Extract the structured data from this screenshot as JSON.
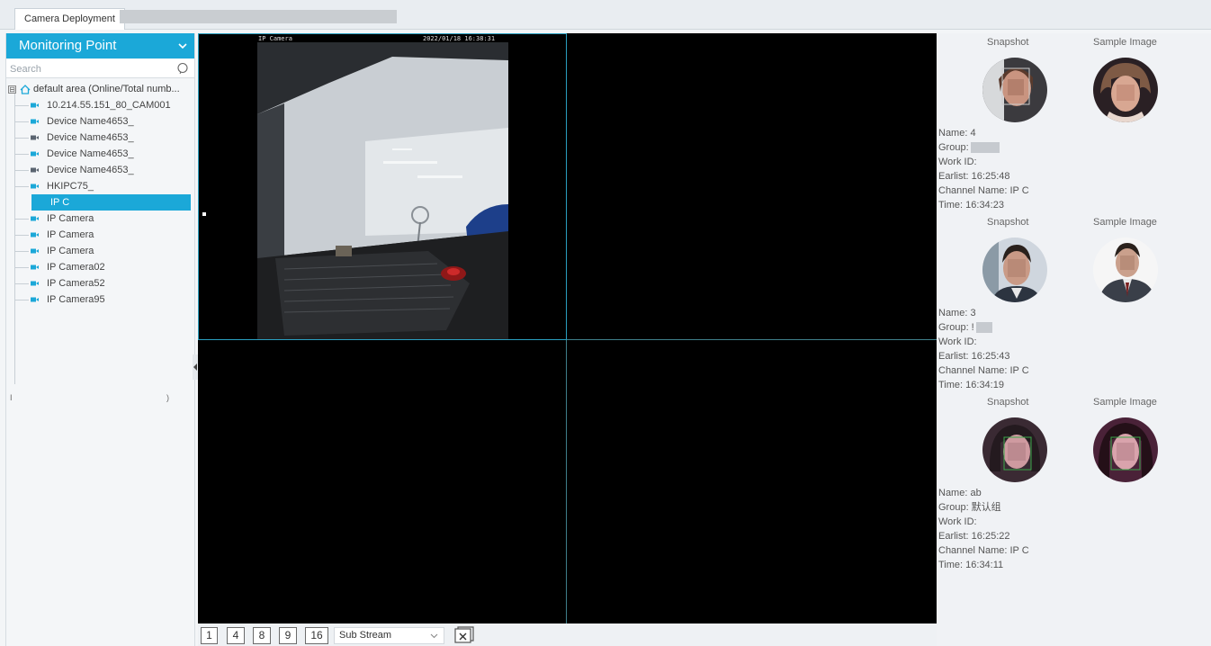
{
  "tabs": {
    "active_label": "Camera Deployment"
  },
  "sidebar": {
    "title": "Monitoring Point",
    "search_placeholder": "Search",
    "root_label": "default area (Online/Total numb...",
    "root_toggle": "⊟",
    "items": [
      {
        "label": "10.214.55.151_80_CAM001",
        "online": true
      },
      {
        "label": "Device Name4653_",
        "online": true
      },
      {
        "label": "Device Name4653_",
        "online": false
      },
      {
        "label": "Device Name4653_",
        "online": true
      },
      {
        "label": "Device Name4653_",
        "online": false
      },
      {
        "label": "HKIPC75_",
        "online": true
      },
      {
        "label": "IP C",
        "online": true,
        "selected": true
      },
      {
        "label": "IP Camera",
        "online": true
      },
      {
        "label": "IP Camera",
        "online": true
      },
      {
        "label": "IP Camera",
        "online": true
      },
      {
        "label": "IP Camera02",
        "online": true
      },
      {
        "label": "IP Camera52",
        "online": true
      },
      {
        "label": "IP Camera95",
        "online": true
      }
    ],
    "stray_left": "I",
    "stray_right": ")"
  },
  "video": {
    "osd_name": "IP Camera",
    "osd_time": "2022/01/18 16:38:31"
  },
  "toolbar": {
    "layouts": [
      "1",
      "4",
      "8",
      "9",
      "16"
    ],
    "stream_value": "Sub Stream"
  },
  "matches": [
    {
      "snapshot_header": "Snapshot",
      "sample_header": "Sample Image",
      "name": "Name: 4",
      "group": "Group:",
      "work_id": "Work ID:",
      "earliest": "Earlist: 16:25:48",
      "channel": "Channel Name: IP C",
      "time": "Time: 16:34:23"
    },
    {
      "snapshot_header": "Snapshot",
      "sample_header": "Sample Image",
      "name": "Name: 3",
      "group": "Group: !",
      "work_id": "Work ID:",
      "earliest": "Earlist: 16:25:43",
      "channel": "Channel Name: IP C",
      "time": "Time: 16:34:19"
    },
    {
      "snapshot_header": "Snapshot",
      "sample_header": "Sample Image",
      "name": "Name: ab",
      "group": "Group: 默认组",
      "work_id": "Work ID:",
      "earliest": "Earlist: 16:25:22",
      "channel": "Channel Name: IP C",
      "time": "Time: 16:34:11"
    }
  ],
  "colors": {
    "accent": "#1ba8d8",
    "online_cam": "#1ba8d8",
    "offline_cam": "#5a6470"
  }
}
